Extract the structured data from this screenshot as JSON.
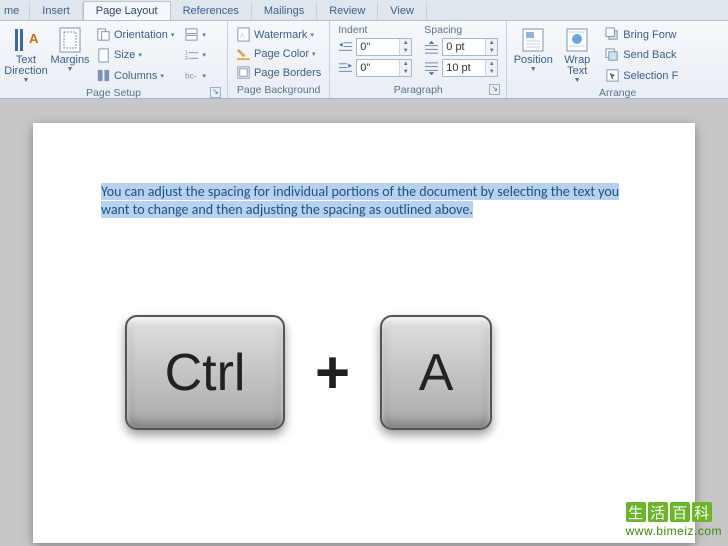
{
  "tabs": {
    "home": "me",
    "insert": "Insert",
    "pagelayout": "Page Layout",
    "references": "References",
    "mailings": "Mailings",
    "review": "Review",
    "view": "View"
  },
  "page_setup": {
    "text_direction": "Text\nDirection",
    "margins": "Margins",
    "orientation": "Orientation",
    "size": "Size",
    "columns": "Columns",
    "label": "Page Setup"
  },
  "page_bg": {
    "watermark": "Watermark",
    "page_color": "Page Color",
    "page_borders": "Page Borders",
    "label": "Page Background"
  },
  "paragraph": {
    "indent_heading": "Indent",
    "spacing_heading": "Spacing",
    "indent_left": "0\"",
    "indent_right": "0\"",
    "space_before": "0 pt",
    "space_after": "10 pt",
    "label": "Paragraph"
  },
  "arrange": {
    "position": "Position",
    "wrap_text": "Wrap\nText",
    "bring_forward": "Bring Forw",
    "send_back": "Send Back",
    "selection": "Selection F",
    "label": "Arrange"
  },
  "doc": {
    "text": "You can adjust the spacing for individual portions of the document by selecting the text you want to change and then adjusting the spacing as outlined above."
  },
  "overlay": {
    "key1": "Ctrl",
    "plus": "+",
    "key2": "A"
  },
  "watermark": {
    "c1": "生",
    "c2": "活",
    "c3": "百",
    "c4": "科",
    "url": "www.bimeiz.com"
  }
}
